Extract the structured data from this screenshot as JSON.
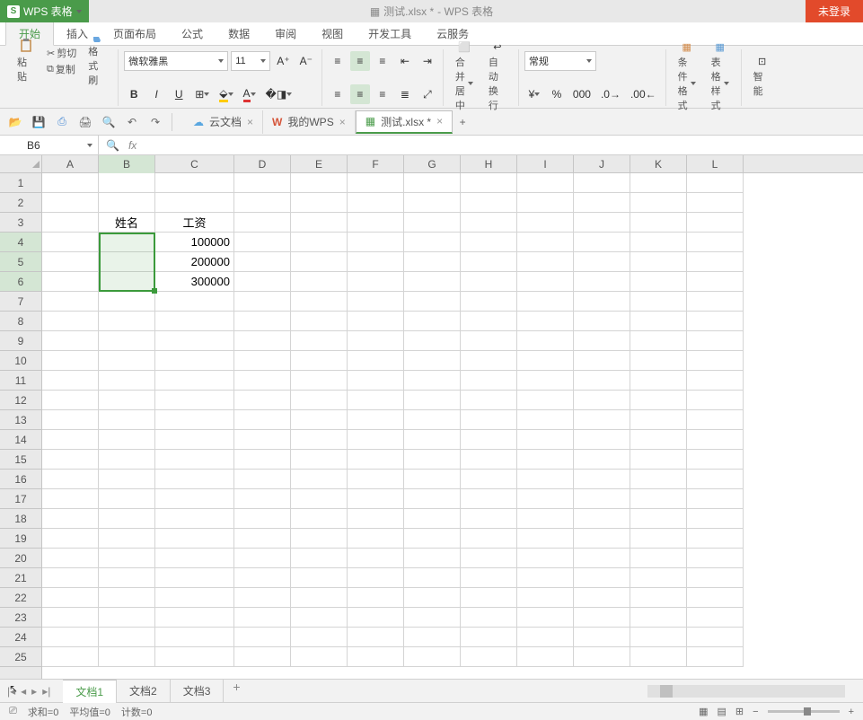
{
  "app": {
    "name": "WPS 表格",
    "title_doc": "测试.xlsx *",
    "title_suffix": "- WPS 表格",
    "login": "未登录"
  },
  "ribbon_tabs": [
    "开始",
    "插入",
    "页面布局",
    "公式",
    "数据",
    "审阅",
    "视图",
    "开发工具",
    "云服务"
  ],
  "ribbon": {
    "paste": "粘贴",
    "cut": "剪切",
    "copy": "复制",
    "fmt_painter": "格式刷",
    "font_name": "微软雅黑",
    "font_size": "11",
    "merge": "合并居中",
    "wrap": "自动换行",
    "num_fmt": "常规",
    "cond_fmt": "条件格式",
    "tbl_style": "表格样式",
    "smart": "智能"
  },
  "doc_tabs": [
    {
      "label": "云文档",
      "icon": "cloud",
      "active": false
    },
    {
      "label": "我的WPS",
      "icon": "wps",
      "active": false
    },
    {
      "label": "测试.xlsx *",
      "icon": "xlsx",
      "active": true
    }
  ],
  "namebox": "B6",
  "columns": [
    "A",
    "B",
    "C",
    "D",
    "E",
    "F",
    "G",
    "H",
    "I",
    "J",
    "K",
    "L"
  ],
  "rows": 25,
  "selected_col": "B",
  "selected_rows": [
    4,
    5,
    6
  ],
  "cells": {
    "B3": "姓名",
    "C3": "工资",
    "C4": "100000",
    "C5": "200000",
    "C6": "300000"
  },
  "sheet_tabs": [
    "文档1",
    "文档2",
    "文档3"
  ],
  "active_sheet": 0,
  "status": {
    "sum": "求和=0",
    "avg": "平均值=0",
    "count": "计数=0"
  }
}
